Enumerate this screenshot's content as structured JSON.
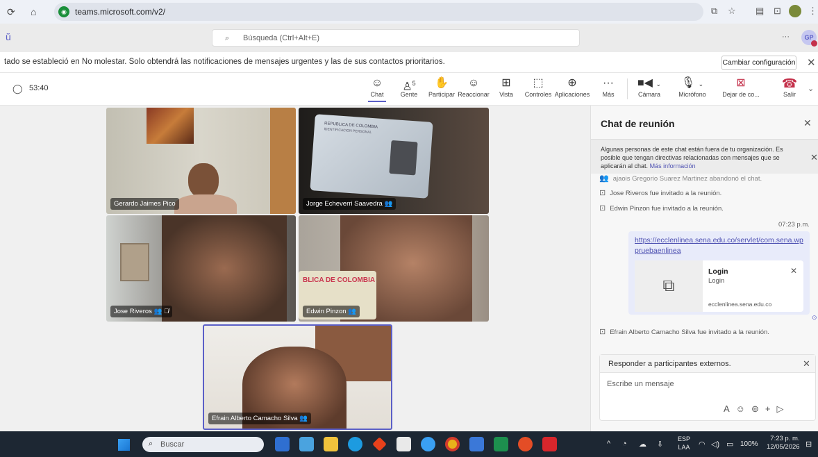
{
  "browser": {
    "url": "teams.microsoft.com/v2/"
  },
  "header": {
    "search_placeholder": "Búsqueda (Ctrl+Alt+E)",
    "avatar_initials": "GP",
    "more": "···"
  },
  "notice": {
    "text": "tado se estableció en No molestar. Solo obtendrá las notificaciones de mensajes urgentes y las de sus contactos prioritarios.",
    "button": "Cambiar configuración"
  },
  "meeting": {
    "timer": "53:40",
    "people_count": "5",
    "toolbar": {
      "chat": "Chat",
      "people": "Gente",
      "raise": "Participar",
      "react": "Reaccionar",
      "view": "Vista",
      "controls": "Controles",
      "apps": "Aplicaciones",
      "more": "Más",
      "camera": "Cámara",
      "mic": "Micrófono",
      "share": "Dejar de co...",
      "leave": "Salir"
    }
  },
  "participants": [
    {
      "name": "Gerardo Jaimes Pico"
    },
    {
      "name": "Jorge Echeverri Saavedra"
    },
    {
      "name": "Jose Riveros"
    },
    {
      "name": "Edwin Pinzon"
    },
    {
      "name": "Efrain Alberto Camacho Silva"
    }
  ],
  "video_text": {
    "id_card_top": "REPUBLICA DE COLOMBIA",
    "id_card_sub": "IDENTIFICACION PERSONAL",
    "banner": "BLICA DE COLOMBIA"
  },
  "chat": {
    "title": "Chat de reunión",
    "warning": "Algunas personas de este chat están fuera de tu organización. Es posible que tengan directivas relacionadas con mensajes que se aplicarán al chat.",
    "warning_link": "Más información",
    "events": [
      {
        "text": "ajaois Gregorio Suarez Martinez  abandonó el chat."
      },
      {
        "text": "Jose Riveros  fue invitado a la reunión."
      },
      {
        "text": "Edwin Pinzon  fue invitado a la reunión."
      }
    ],
    "message_time": "07:23 p.m.",
    "message_link": "https://ecclenlinea.sena.edu.co/servlet/com.sena.wppruebaenlinea",
    "preview_title": "Login",
    "preview_subtitle": "Login",
    "preview_domain": "ecclenlinea.sena.edu.co",
    "event_last": "Efrain Alberto Camacho Silva  fue invitado a la reunión.",
    "reply_label": "Responder a participantes externos.",
    "compose_placeholder": "Escribe un mensaje"
  },
  "taskbar": {
    "search": "Buscar",
    "lang": "ESP",
    "lang2": "LAA",
    "battery": "100%",
    "time": "7:23 p. m.",
    "date": "12/05/2026"
  },
  "colors": {
    "teams_purple": "#5b5fc7",
    "leave_red": "#c4314b",
    "link_blue": "#4f52b2"
  }
}
